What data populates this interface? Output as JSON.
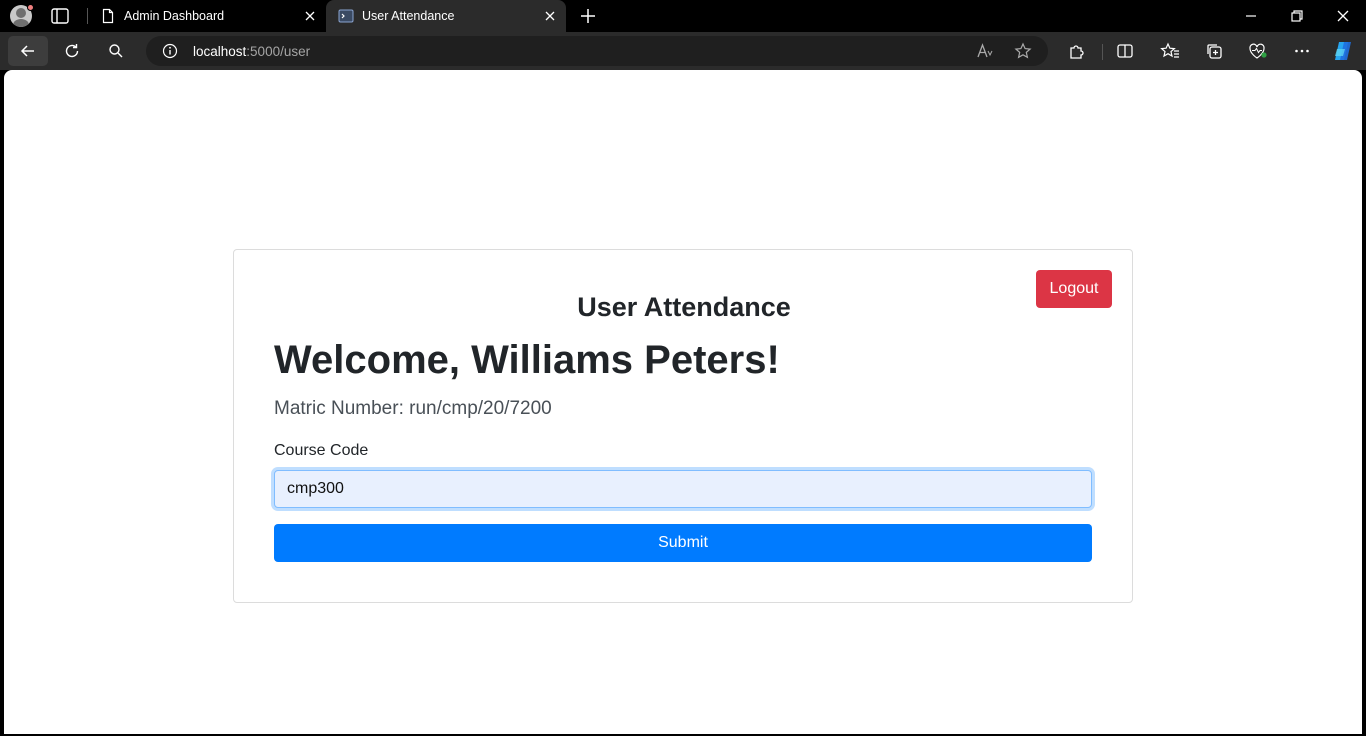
{
  "browser": {
    "tabs": [
      {
        "title": "Admin Dashboard",
        "active": false,
        "icon": "page-icon"
      },
      {
        "title": "User Attendance",
        "active": true,
        "icon": "terminal-icon"
      }
    ],
    "address": {
      "host": "localhost",
      "rest": ":5000/user"
    }
  },
  "page": {
    "logout_label": "Logout",
    "title": "User Attendance",
    "welcome": "Welcome, Williams Peters!",
    "matric": "Matric Number: run/cmp/20/7200",
    "course_label": "Course Code",
    "course_value": "cmp300",
    "submit_label": "Submit"
  },
  "colors": {
    "logout": "#dc3545",
    "submit": "#007bff",
    "input_bg": "#e8f0fe"
  }
}
